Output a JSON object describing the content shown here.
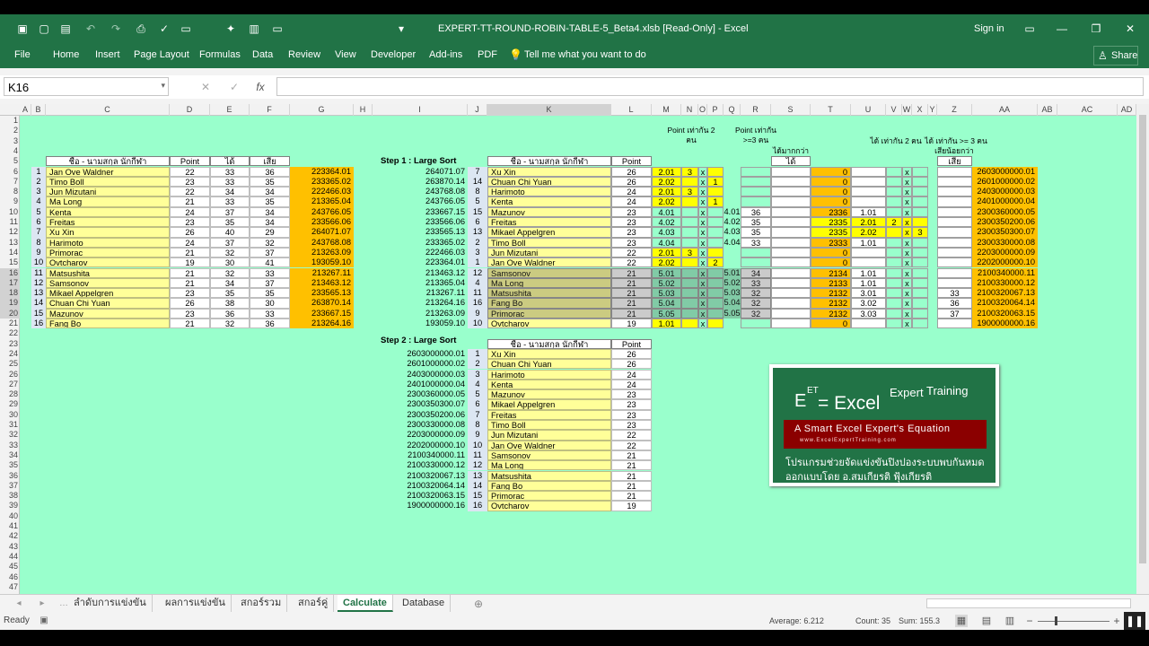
{
  "window": {
    "title": "EXPERT-TT-ROUND-ROBIN-TABLE-5_Beta4.xlsb  [Read-Only]  -  Excel",
    "sign_in": "Sign in"
  },
  "ribbon": {
    "tabs": [
      "File",
      "Home",
      "Insert",
      "Page Layout",
      "Formulas",
      "Data",
      "Review",
      "View",
      "Developer",
      "Add-ins",
      "PDF"
    ],
    "tell_me": "Tell me what you want to do",
    "share": "Share"
  },
  "formula_bar": {
    "name_box": "K16",
    "content": ""
  },
  "columns": [
    "A",
    "B",
    "C",
    "D",
    "E",
    "F",
    "G",
    "H",
    "I",
    "J",
    "K",
    "L",
    "M",
    "N",
    "O",
    "P",
    "Q",
    "R",
    "S",
    "T",
    "U",
    "V",
    "W",
    "X",
    "Y",
    "Z",
    "AA",
    "AB",
    "AC",
    "AD"
  ],
  "left_table": {
    "headers": [
      "ชื่อ - นามสกุล นักกีฬา",
      "Point",
      "ได้",
      "เสีย"
    ],
    "rows": [
      [
        "1",
        "Jan Ove Waldner",
        "22",
        "33",
        "36",
        "223364.01"
      ],
      [
        "2",
        "Timo Boll",
        "23",
        "33",
        "35",
        "233365.02"
      ],
      [
        "3",
        "Jun Mizutani",
        "22",
        "34",
        "34",
        "222466.03"
      ],
      [
        "4",
        "Ma Long",
        "21",
        "33",
        "35",
        "213365.04"
      ],
      [
        "5",
        "Kenta",
        "24",
        "37",
        "34",
        "243766.05"
      ],
      [
        "6",
        "Freitas",
        "23",
        "35",
        "34",
        "233566.06"
      ],
      [
        "7",
        "Xu Xin",
        "26",
        "40",
        "29",
        "264071.07"
      ],
      [
        "8",
        "Harimoto",
        "24",
        "37",
        "32",
        "243768.08"
      ],
      [
        "9",
        "Primorac",
        "21",
        "32",
        "37",
        "213263.09"
      ],
      [
        "10",
        "Ovtcharov",
        "19",
        "30",
        "41",
        "193059.10"
      ],
      [
        "11",
        "Matsushita",
        "21",
        "32",
        "33",
        "213267.11"
      ],
      [
        "12",
        "Samsonov",
        "21",
        "34",
        "37",
        "213463.12"
      ],
      [
        "13",
        "Mikael Appelgren",
        "23",
        "35",
        "35",
        "233565.13"
      ],
      [
        "14",
        "Chuan Chi Yuan",
        "26",
        "38",
        "30",
        "263870.14"
      ],
      [
        "15",
        "Mazunov",
        "23",
        "36",
        "33",
        "233667.15"
      ],
      [
        "16",
        "Fang Bo",
        "21",
        "32",
        "36",
        "213264.16"
      ]
    ]
  },
  "step1": {
    "label": "Step 1 : Large Sort",
    "headers": [
      "ชื่อ - นามสกุล นักกีฬา",
      "Point"
    ],
    "group_headers": {
      "m": "Point เท่ากัน 2 คน",
      "r": "Point เท่ากัน >=3 คน",
      "s": "ได้มากกว่า",
      "s2": "ได้",
      "u": "ได้ เท่ากัน 2 คน",
      "z": "ได้ เท่ากัน >= 3 คน",
      "z2": "เสียน้อยกว่า",
      "z3": "เสีย"
    },
    "rows": [
      [
        "264071.07",
        "7",
        "Xu Xin",
        "26",
        "2.01",
        "3",
        "x",
        "",
        "",
        "",
        "",
        "0",
        "",
        "",
        "x",
        "",
        "",
        "2603000000.01"
      ],
      [
        "263870.14",
        "14",
        "Chuan Chi Yuan",
        "26",
        "2.02",
        "",
        "x",
        "1",
        "",
        "",
        "",
        "0",
        "",
        "",
        "x",
        "",
        "",
        "2601000000.02"
      ],
      [
        "243768.08",
        "8",
        "Harimoto",
        "24",
        "2.01",
        "3",
        "x",
        "",
        "",
        "",
        "",
        "0",
        "",
        "",
        "x",
        "",
        "",
        "2403000000.03"
      ],
      [
        "243766.05",
        "5",
        "Kenta",
        "24",
        "2.02",
        "",
        "x",
        "1",
        "",
        "",
        "",
        "0",
        "",
        "",
        "x",
        "",
        "",
        "2401000000.04"
      ],
      [
        "233667.15",
        "15",
        "Mazunov",
        "23",
        "4.01",
        "",
        "x",
        "",
        "4.01",
        "36",
        "",
        "2336",
        "1.01",
        "",
        "x",
        "",
        "",
        "2300360000.05"
      ],
      [
        "233566.06",
        "6",
        "Freitas",
        "23",
        "4.02",
        "",
        "x",
        "",
        "4.02",
        "35",
        "",
        "2335",
        "2.01",
        "2",
        "x",
        "",
        "",
        "2300350200.06"
      ],
      [
        "233565.13",
        "13",
        "Mikael Appelgren",
        "23",
        "4.03",
        "",
        "x",
        "",
        "4.03",
        "35",
        "",
        "2335",
        "2.02",
        "",
        "x",
        "3",
        "",
        "2300350300.07"
      ],
      [
        "233365.02",
        "2",
        "Timo Boll",
        "23",
        "4.04",
        "",
        "x",
        "",
        "4.04",
        "33",
        "",
        "2333",
        "1.01",
        "",
        "x",
        "",
        "",
        "2300330000.08"
      ],
      [
        "222466.03",
        "3",
        "Jun Mizutani",
        "22",
        "2.01",
        "3",
        "x",
        "",
        "",
        "",
        "",
        "0",
        "",
        "",
        "x",
        "",
        "",
        "2203000000.09"
      ],
      [
        "223364.01",
        "1",
        "Jan Ove Waldner",
        "22",
        "2.02",
        "",
        "x",
        "2",
        "",
        "",
        "",
        "0",
        "",
        "",
        "x",
        "",
        "",
        "2202000000.10"
      ],
      [
        "213463.12",
        "12",
        "Samsonov",
        "21",
        "5.01",
        "",
        "x",
        "",
        "5.01",
        "34",
        "",
        "2134",
        "1.01",
        "",
        "x",
        "",
        "",
        "2100340000.11"
      ],
      [
        "213365.04",
        "4",
        "Ma Long",
        "21",
        "5.02",
        "",
        "x",
        "",
        "5.02",
        "33",
        "",
        "2133",
        "1.01",
        "",
        "x",
        "",
        "",
        "2100330000.12"
      ],
      [
        "213267.11",
        "11",
        "Matsushita",
        "21",
        "5.03",
        "",
        "x",
        "",
        "5.03",
        "32",
        "",
        "2132",
        "3.01",
        "",
        "x",
        "",
        "33",
        "2100320067.13"
      ],
      [
        "213264.16",
        "16",
        "Fang Bo",
        "21",
        "5.04",
        "",
        "x",
        "",
        "5.04",
        "32",
        "",
        "2132",
        "3.02",
        "",
        "x",
        "",
        "36",
        "2100320064.14"
      ],
      [
        "213263.09",
        "9",
        "Primorac",
        "21",
        "5.05",
        "",
        "x",
        "",
        "5.05",
        "32",
        "",
        "2132",
        "3.03",
        "",
        "x",
        "",
        "37",
        "2100320063.15"
      ],
      [
        "193059.10",
        "10",
        "Ovtcharov",
        "19",
        "1.01",
        "",
        "x",
        "",
        "",
        "",
        "",
        "0",
        "",
        "",
        "x",
        "",
        "",
        "1900000000.16"
      ]
    ]
  },
  "step2": {
    "label": "Step 2 : Large Sort",
    "headers": [
      "ชื่อ - นามสกุล นักกีฬา",
      "Point"
    ],
    "rows": [
      [
        "2603000000.01",
        "1",
        "Xu Xin",
        "26"
      ],
      [
        "2601000000.02",
        "2",
        "Chuan Chi Yuan",
        "26"
      ],
      [
        "2403000000.03",
        "3",
        "Harimoto",
        "24"
      ],
      [
        "2401000000.04",
        "4",
        "Kenta",
        "24"
      ],
      [
        "2300360000.05",
        "5",
        "Mazunov",
        "23"
      ],
      [
        "2300350300.07",
        "6",
        "Mikael Appelgren",
        "23"
      ],
      [
        "2300350200.06",
        "7",
        "Freitas",
        "23"
      ],
      [
        "2300330000.08",
        "8",
        "Timo Boll",
        "23"
      ],
      [
        "2203000000.09",
        "9",
        "Jun Mizutani",
        "22"
      ],
      [
        "2202000000.10",
        "10",
        "Jan Ove Waldner",
        "22"
      ],
      [
        "2100340000.11",
        "11",
        "Samsonov",
        "21"
      ],
      [
        "2100330000.12",
        "12",
        "Ma Long",
        "21"
      ],
      [
        "2100320067.13",
        "13",
        "Matsushita",
        "21"
      ],
      [
        "2100320064.14",
        "14",
        "Fang Bo",
        "21"
      ],
      [
        "2100320063.15",
        "15",
        "Primorac",
        "21"
      ],
      [
        "1900000000.16",
        "16",
        "Ovtcharov",
        "19"
      ]
    ]
  },
  "logo": {
    "line1a": "E",
    "line1b": "ET",
    "line1c": " = Excel",
    "line1d": "Expert",
    "line1e": "Training",
    "tagline": "A Smart Excel Expert's Equation",
    "url": "www.ExcelExpertTraining.com",
    "thai1": "โปรแกรมช่วยจัดแข่งขันปิงปองระบบพบกันหมด",
    "thai2": "ออกแบบโดย อ.สมเกียรติ ฟุ้งเกียรติ"
  },
  "sheet_tabs": [
    "ลำดับการแข่งขัน",
    "ผลการแข่งขัน",
    "สกอร์รวม",
    "สกอร์คู่",
    "Calculate",
    "Database"
  ],
  "active_tab": "Calculate",
  "status": {
    "ready": "Ready",
    "average": "Average: 6.212",
    "count": "Count: 35",
    "sum": "Sum: 155.3"
  }
}
